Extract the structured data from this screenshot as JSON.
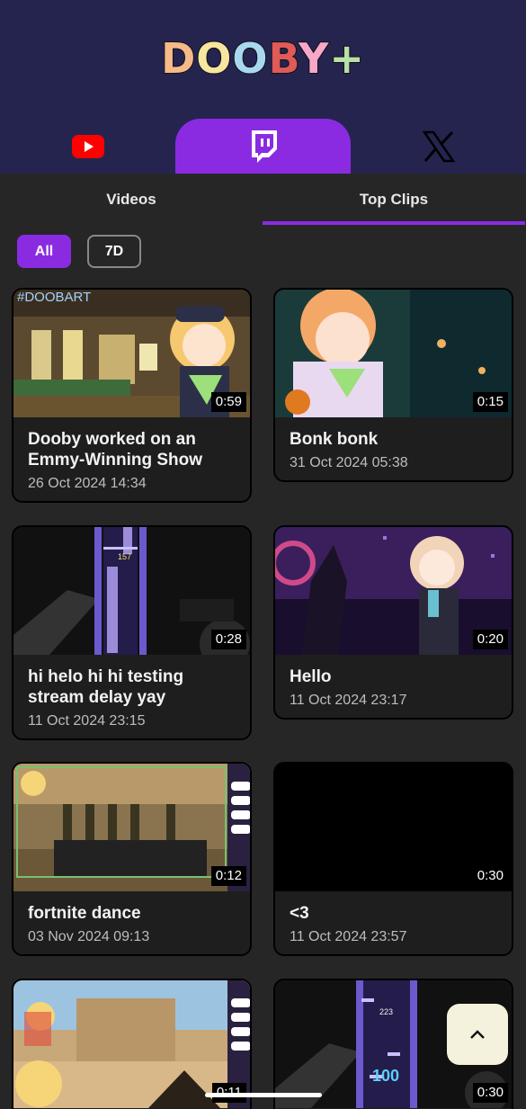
{
  "app": {
    "logo_letters": [
      {
        "ch": "D",
        "color": "#f6b98a"
      },
      {
        "ch": "O",
        "color": "#f7e6a0"
      },
      {
        "ch": "O",
        "color": "#a8d8f0"
      },
      {
        "ch": "B",
        "color": "#e05a5a"
      },
      {
        "ch": "Y",
        "color": "#f7a8c8"
      },
      {
        "ch": "+",
        "color": "#b8e0a8"
      }
    ]
  },
  "platforms": [
    {
      "name": "youtube-tab",
      "icon": "youtube-icon",
      "active": false
    },
    {
      "name": "twitch-tab",
      "icon": "twitch-icon",
      "active": true
    },
    {
      "name": "x-tab",
      "icon": "x-icon",
      "active": false
    }
  ],
  "sub_tabs": {
    "videos": "Videos",
    "top_clips": "Top Clips"
  },
  "filters": {
    "all": "All",
    "seven_days": "7D"
  },
  "colors": {
    "accent": "#8a2be2",
    "header": "#25244f",
    "background": "#262626"
  },
  "clips": [
    {
      "title": "Dooby worked on an Emmy-Winning Show",
      "date": "26 Oct 2024 14:34",
      "duration": "0:59",
      "overlay": "#DOOBART"
    },
    {
      "title": "Bonk bonk",
      "date": "31 Oct 2024 05:38",
      "duration": "0:15"
    },
    {
      "title": "hi helo hi hi testing stream delay yay",
      "date": "11 Oct 2024 23:15",
      "duration": "0:28",
      "overlay": "157"
    },
    {
      "title": "Hello",
      "date": "11 Oct 2024 23:17",
      "duration": "0:20"
    },
    {
      "title": "fortnite dance",
      "date": "03 Nov 2024 09:13",
      "duration": "0:12"
    },
    {
      "title": "<3",
      "date": "11 Oct 2024 23:57",
      "duration": "0:30"
    },
    {
      "title": "",
      "date": "",
      "duration": "0:11"
    },
    {
      "title": "",
      "date": "",
      "duration": "0:30",
      "overlay": "223",
      "overlay2": "100"
    }
  ],
  "scroll_top": {
    "icon": "chevron-up-icon"
  }
}
